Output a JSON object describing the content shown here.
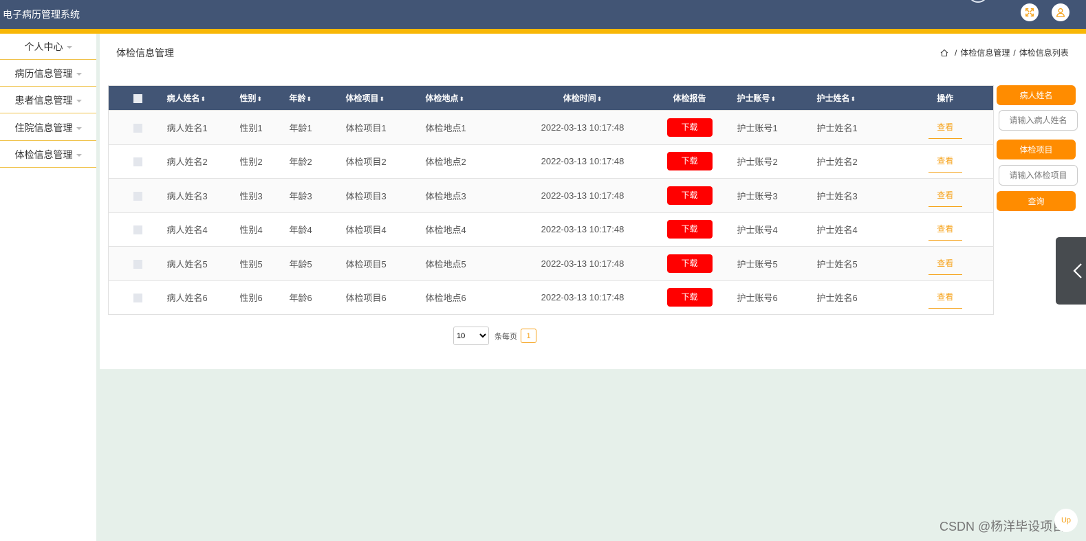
{
  "app": {
    "title": "电子病历管理系统"
  },
  "header": {
    "fullscreen_icon": "expand-icon",
    "user_icon": "user-icon"
  },
  "sidebar": {
    "items": [
      {
        "label": "个人中心"
      },
      {
        "label": "病历信息管理"
      },
      {
        "label": "患者信息管理"
      },
      {
        "label": "住院信息管理"
      },
      {
        "label": "体检信息管理"
      }
    ]
  },
  "page": {
    "title": "体检信息管理",
    "breadcrumb": [
      "体检信息管理",
      "体检信息列表"
    ],
    "breadcrumb_sep": "/"
  },
  "table": {
    "columns": [
      {
        "label": "病人姓名",
        "sort": "⬍"
      },
      {
        "label": "性别",
        "sort": "⬍"
      },
      {
        "label": "年龄",
        "sort": "⬍"
      },
      {
        "label": "体检项目",
        "sort": "⬍"
      },
      {
        "label": "体检地点",
        "sort": "⬍"
      },
      {
        "label": "体检时间",
        "sort": "⬍"
      },
      {
        "label": "体检报告",
        "sort": ""
      },
      {
        "label": "护士账号",
        "sort": "⬍"
      },
      {
        "label": "护士姓名",
        "sort": "⬍"
      },
      {
        "label": "操作",
        "sort": ""
      }
    ],
    "download_label": "下载",
    "view_label": "查看",
    "rows": [
      {
        "name": "病人姓名1",
        "gender": "性别1",
        "age": "年龄1",
        "item": "体检项目1",
        "location": "体检地点1",
        "time": "2022-03-13 10:17:48",
        "nurse_account": "护士账号1",
        "nurse_name": "护士姓名1"
      },
      {
        "name": "病人姓名2",
        "gender": "性别2",
        "age": "年龄2",
        "item": "体检项目2",
        "location": "体检地点2",
        "time": "2022-03-13 10:17:48",
        "nurse_account": "护士账号2",
        "nurse_name": "护士姓名2"
      },
      {
        "name": "病人姓名3",
        "gender": "性别3",
        "age": "年龄3",
        "item": "体检项目3",
        "location": "体检地点3",
        "time": "2022-03-13 10:17:48",
        "nurse_account": "护士账号3",
        "nurse_name": "护士姓名3"
      },
      {
        "name": "病人姓名4",
        "gender": "性别4",
        "age": "年龄4",
        "item": "体检项目4",
        "location": "体检地点4",
        "time": "2022-03-13 10:17:48",
        "nurse_account": "护士账号4",
        "nurse_name": "护士姓名4"
      },
      {
        "name": "病人姓名5",
        "gender": "性别5",
        "age": "年龄5",
        "item": "体检项目5",
        "location": "体检地点5",
        "time": "2022-03-13 10:17:48",
        "nurse_account": "护士账号5",
        "nurse_name": "护士姓名5"
      },
      {
        "name": "病人姓名6",
        "gender": "性别6",
        "age": "年龄6",
        "item": "体检项目6",
        "location": "体检地点6",
        "time": "2022-03-13 10:17:48",
        "nurse_account": "护士账号6",
        "nurse_name": "护士姓名6"
      }
    ]
  },
  "pagination": {
    "page_size": "10",
    "page_size_options": [
      "10"
    ],
    "per_page_label": "条每页",
    "current_page": "1"
  },
  "search": {
    "name_label": "病人姓名",
    "name_placeholder": "请输入病人姓名",
    "item_label": "体检项目",
    "item_placeholder": "请输入体检项目",
    "query_label": "查询"
  },
  "watermark": "CSDN @杨洋毕设项目",
  "corner_button": "Up",
  "colors": {
    "header": "#425575",
    "stripe": "#f8b707",
    "accent": "#ff8c00",
    "download": "#ff0000",
    "view": "#f6a31c"
  }
}
